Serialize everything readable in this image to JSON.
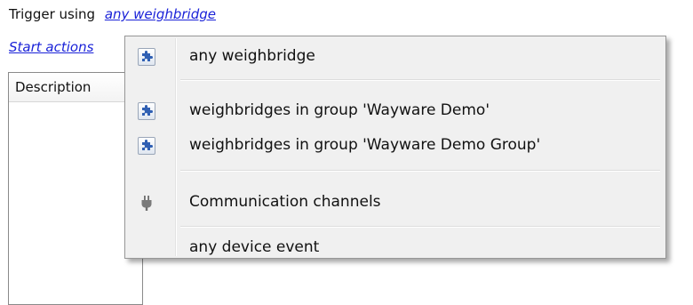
{
  "trigger": {
    "label": "Trigger using",
    "link": "any weighbridge"
  },
  "start_actions": {
    "link": "Start actions"
  },
  "list": {
    "header": "Description"
  },
  "menu": {
    "items": [
      {
        "label": "any weighbridge",
        "icon": "puzzle-icon"
      },
      {
        "label": "weighbridges in group 'Wayware Demo'",
        "icon": "puzzle-icon"
      },
      {
        "label": "weighbridges in group 'Wayware Demo Group'",
        "icon": "puzzle-icon"
      },
      {
        "label": "Communication channels",
        "icon": "plug-icon"
      },
      {
        "label": "any device event",
        "icon": ""
      }
    ]
  },
  "colors": {
    "link": "#1a22d8",
    "menu_background": "#f0f0f0",
    "icon_blue": "#2f5fb3"
  }
}
